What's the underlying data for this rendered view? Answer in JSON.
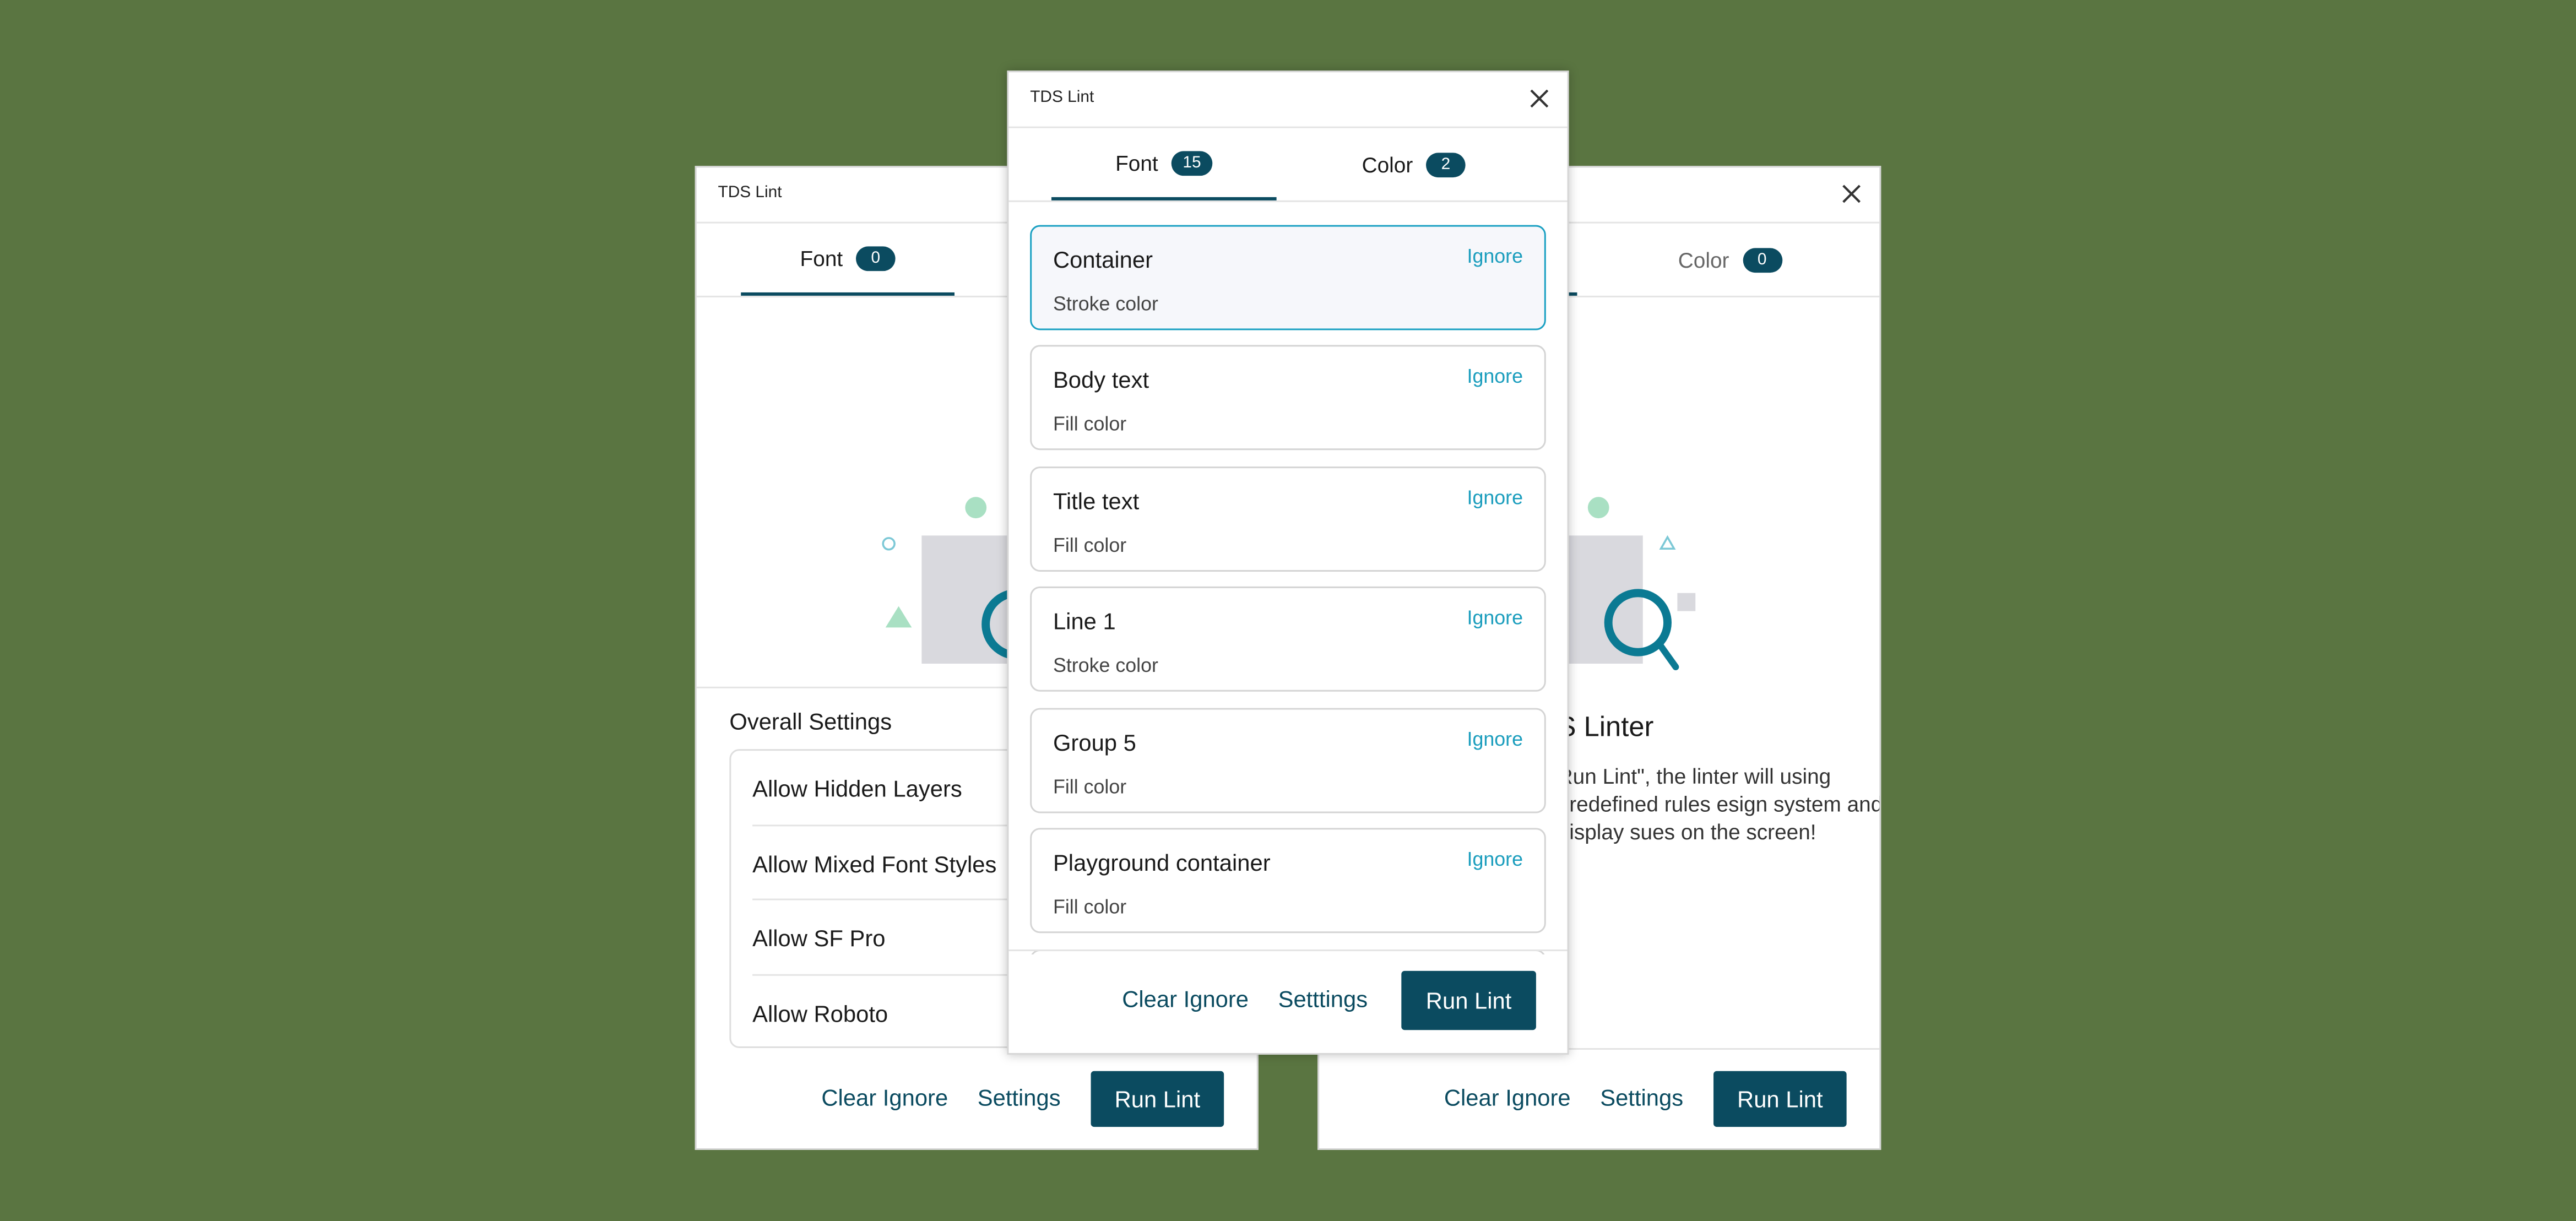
{
  "colors": {
    "background": "#5a7541",
    "primary": "#0b4b60",
    "accent": "#1aa0c2",
    "illustration_green": "#a9e0c3",
    "illustration_gray": "#d9d9de"
  },
  "left_window": {
    "title": "TDS Lint",
    "tabs": [
      {
        "label": "Font",
        "count": "0"
      }
    ],
    "settings": {
      "heading": "Overall Settings",
      "items": [
        "Allow Hidden Layers",
        "Allow Mixed Font Styles",
        "Allow SF Pro",
        "Allow Roboto"
      ]
    },
    "footer": {
      "clear_ignore": "Clear Ignore",
      "settings": "Settings",
      "run_lint": "Run Lint"
    }
  },
  "right_window": {
    "tabs": [
      {
        "label": "Color",
        "count": "0"
      }
    ],
    "heading": "S Linter",
    "description": "Run Lint\", the linter will using predefined rules esign system and display sues on the screen!",
    "footer": {
      "clear_ignore": "Clear Ignore",
      "settings": "Settings",
      "run_lint": "Run Lint"
    }
  },
  "center_window": {
    "title": "TDS Lint",
    "tabs": [
      {
        "label": "Font",
        "count": "15"
      },
      {
        "label": "Color",
        "count": "2"
      }
    ],
    "issues": [
      {
        "title": "Container",
        "subtitle": "Stroke color",
        "action": "Ignore",
        "selected": true
      },
      {
        "title": "Body text",
        "subtitle": "Fill color",
        "action": "Ignore"
      },
      {
        "title": "Title text",
        "subtitle": "Fill color",
        "action": "Ignore"
      },
      {
        "title": "Line 1",
        "subtitle": "Stroke color",
        "action": "Ignore"
      },
      {
        "title": "Group 5",
        "subtitle": "Fill color",
        "action": "Ignore"
      },
      {
        "title": "Playground container",
        "subtitle": "Fill color",
        "action": "Ignore"
      }
    ],
    "footer": {
      "clear_ignore": "Clear Ignore",
      "settings": "Setttings",
      "run_lint": "Run Lint"
    }
  }
}
